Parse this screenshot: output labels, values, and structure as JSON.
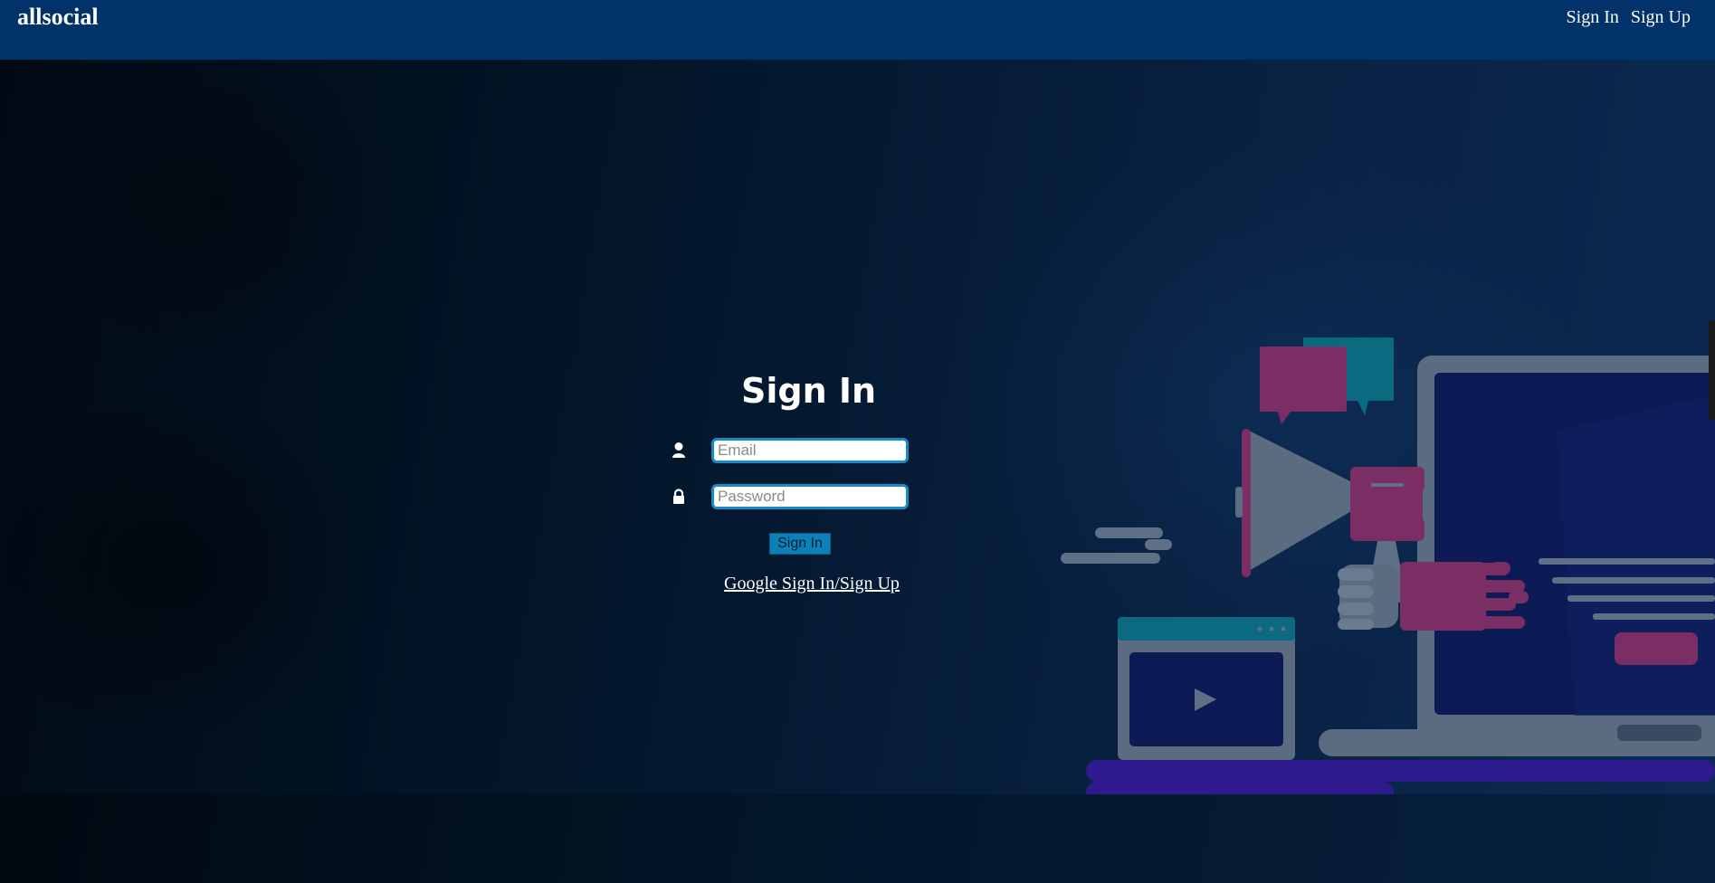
{
  "navbar": {
    "brand": "allsocial",
    "links": [
      {
        "label": "Sign In"
      },
      {
        "label": "Sign Up"
      }
    ]
  },
  "signin": {
    "title": "Sign In",
    "email": {
      "placeholder": "Email",
      "value": "",
      "icon": "user-icon"
    },
    "password": {
      "placeholder": "Password",
      "value": "",
      "icon": "lock-icon"
    },
    "submit_label": "Sign In",
    "google_link": "Google Sign In/Sign Up"
  },
  "illustration": {
    "icons": [
      "megaphone-icon",
      "chat-bubble-icon",
      "laptop-icon",
      "video-player-icon",
      "hand-icon"
    ]
  },
  "colors": {
    "navbar": "#01336a",
    "accent": "#1a8ac6",
    "button": "#0d80b8",
    "magenta": "#7b2e63",
    "teal": "#0b6a80",
    "purple_base": "#2e1a8c"
  }
}
